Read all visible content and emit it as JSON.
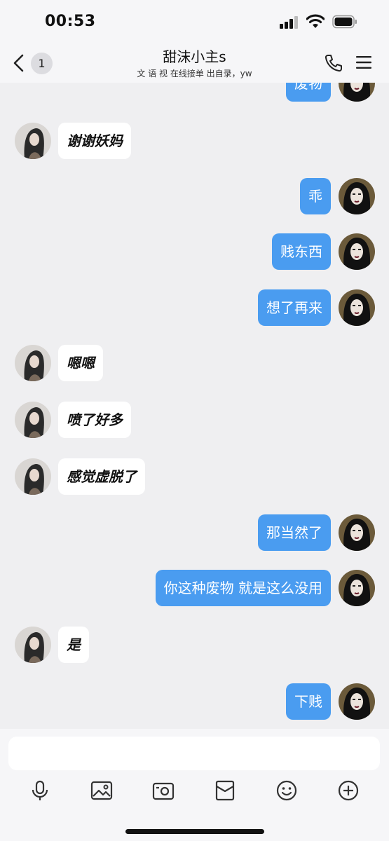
{
  "status_bar": {
    "time": "00:53"
  },
  "header": {
    "unread_count": "1",
    "contact_name": "甜沫小主s",
    "contact_status": "文 语 视  在线接单  出自录，yw"
  },
  "messages": [
    {
      "side": "right",
      "text": "废物"
    },
    {
      "side": "left",
      "text": "谢谢妖妈"
    },
    {
      "side": "right",
      "text": "乖"
    },
    {
      "side": "right",
      "text": "贱东西"
    },
    {
      "side": "right",
      "text": "想了再来"
    },
    {
      "side": "left",
      "text": "嗯嗯"
    },
    {
      "side": "left",
      "text": "喷了好多"
    },
    {
      "side": "left",
      "text": "感觉虚脱了"
    },
    {
      "side": "right",
      "text": "那当然了"
    },
    {
      "side": "right",
      "text": "你这种废物 就是这么没用"
    },
    {
      "side": "left",
      "text": "是"
    },
    {
      "side": "right",
      "text": "下贱"
    }
  ],
  "input": {
    "value": "",
    "placeholder": ""
  },
  "toolbar": {
    "icons": [
      "microphone-icon",
      "image-icon",
      "camera-icon",
      "red-packet-icon",
      "emoji-icon",
      "plus-icon"
    ]
  },
  "colors": {
    "accent": "#4a9cf0",
    "background": "#efeff1",
    "bar": "#f6f6f8"
  }
}
